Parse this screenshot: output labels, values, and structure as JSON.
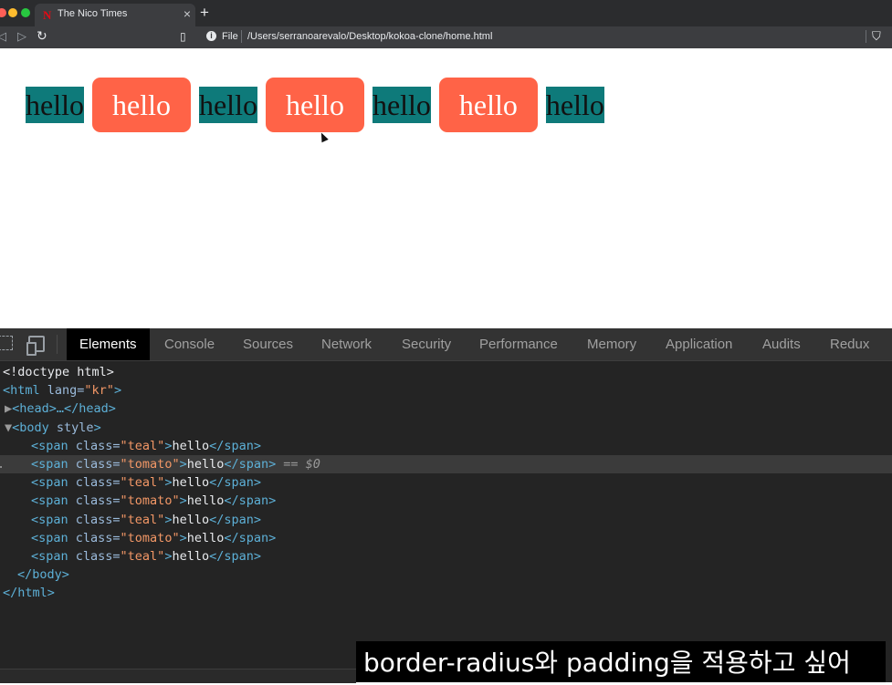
{
  "browser": {
    "tab_title": "The Nico Times",
    "tab_favicon": "N",
    "tab_close": "×",
    "new_tab": "+",
    "file_label": "File",
    "url": "/Users/serranoarevalo/Desktop/kokoa-clone/home.html",
    "icons": {
      "back": "◁",
      "forward": "▷",
      "reload": "↻",
      "bookmark": "▯",
      "info": "i",
      "shield": "⛉"
    }
  },
  "page": {
    "spans": [
      {
        "class": "teal",
        "text": "hello"
      },
      {
        "class": "tomato",
        "text": "hello"
      },
      {
        "class": "teal",
        "text": "hello"
      },
      {
        "class": "tomato",
        "text": "hello"
      },
      {
        "class": "teal",
        "text": "hello"
      },
      {
        "class": "tomato",
        "text": "hello"
      },
      {
        "class": "teal",
        "text": "hello"
      }
    ],
    "colors": {
      "teal": "#0e7a7a",
      "tomato": "#ff6347"
    }
  },
  "devtools": {
    "tabs": [
      "Elements",
      "Console",
      "Sources",
      "Network",
      "Security",
      "Performance",
      "Memory",
      "Application",
      "Audits",
      "Redux"
    ],
    "active_tab": "Elements",
    "dom": {
      "doctype": "<!doctype html>",
      "html_open_tag": "<html",
      "html_attr": " lang=",
      "html_lang": "\"kr\"",
      "html_close_bracket": ">",
      "head_collapsed": "<head>…</head>",
      "body_open": "<body",
      "body_attr": " style",
      "body_close_bracket": ">",
      "span_open": "<span",
      "span_attr": " class=",
      "span_close_bracket": ">",
      "span_text": "hello",
      "span_end": "</span>",
      "selected_marker": "== $0",
      "body_end": "</body>",
      "html_end": "</html>",
      "span_classes": [
        "\"teal\"",
        "\"tomato\"",
        "\"teal\"",
        "\"tomato\"",
        "\"teal\"",
        "\"tomato\"",
        "\"teal\""
      ],
      "selected_index": 1
    }
  },
  "subtitle": "border-radius와 padding을 적용하고 싶어"
}
